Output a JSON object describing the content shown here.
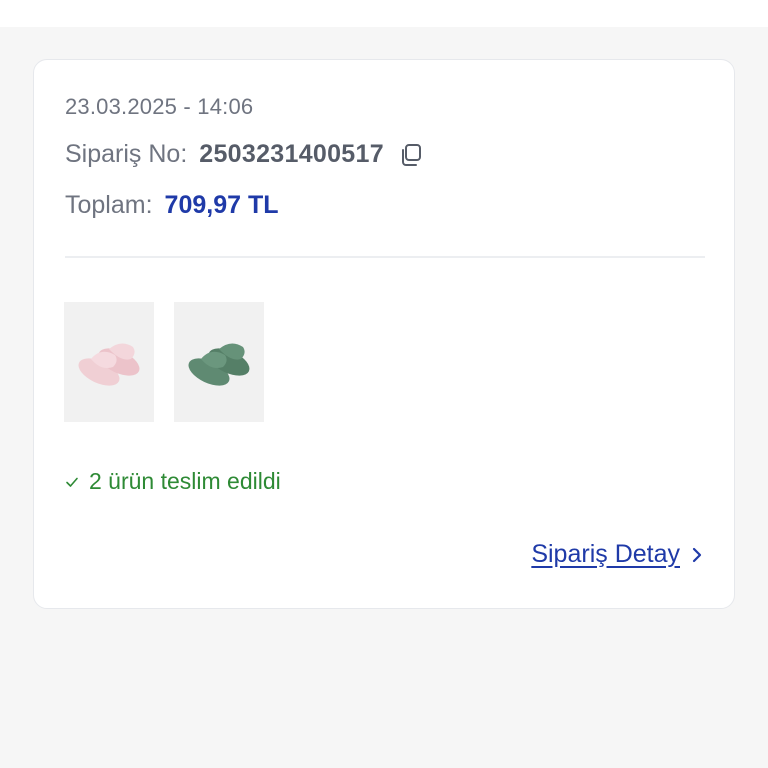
{
  "order": {
    "date": "23.03.2025 - 14:06",
    "order_no_label": "Sipariş No:",
    "order_no": "2503231400517",
    "total_label": "Toplam:",
    "total_value": "709,97 TL",
    "products": [
      {
        "name": "pink-slide-sandal",
        "color": "#f0cfd4"
      },
      {
        "name": "green-slide-sandal",
        "color": "#5f8a72"
      }
    ],
    "status": "2 ürün teslim edildi",
    "detail_link": "Sipariş Detay"
  },
  "icons": {
    "copy": "copy-icon",
    "check": "check-icon",
    "chevron": "chevron-right-icon"
  },
  "colors": {
    "accent": "#1f3aa8",
    "success": "#2e8a35",
    "muted_text": "#6f7480"
  }
}
